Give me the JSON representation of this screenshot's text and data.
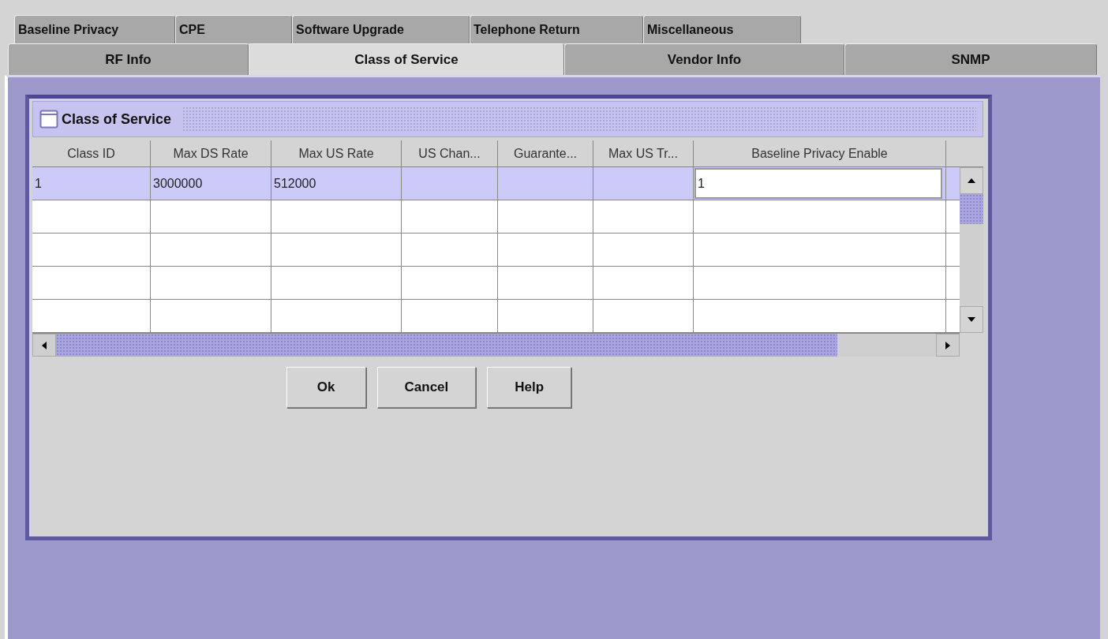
{
  "tab_rows": [
    {
      "tabs": [
        {
          "label": "Baseline Privacy",
          "selected": false
        },
        {
          "label": "CPE",
          "selected": false
        },
        {
          "label": "Software Upgrade",
          "selected": false
        },
        {
          "label": "Telephone Return",
          "selected": false
        },
        {
          "label": "Miscellaneous",
          "selected": false
        }
      ]
    },
    {
      "tabs": [
        {
          "label": "RF Info",
          "selected": false
        },
        {
          "label": "Class of Service",
          "selected": true
        },
        {
          "label": "Vendor Info",
          "selected": false
        },
        {
          "label": "SNMP",
          "selected": false
        }
      ]
    }
  ],
  "frame": {
    "title": "Class of Service"
  },
  "table": {
    "columns": [
      "Class ID",
      "Max DS Rate",
      "Max US Rate",
      "US Chan...",
      "Guarante...",
      "Max US Tr...",
      "Baseline Privacy Enable"
    ],
    "rows": [
      {
        "selected": true,
        "cells": [
          {
            "text": "1",
            "editing": false
          },
          {
            "text": "3000000",
            "editing": false
          },
          {
            "text": "512000",
            "editing": false
          },
          {
            "editing": false
          },
          {
            "editing": false
          },
          {
            "editing": false
          },
          {
            "text": "1",
            "editing": true
          }
        ]
      },
      {
        "selected": false,
        "cells": [
          {
            "editing": false
          },
          {
            "editing": false
          },
          {
            "editing": false
          },
          {
            "editing": false
          },
          {
            "editing": false
          },
          {
            "editing": false
          },
          {
            "editing": false
          }
        ]
      },
      {
        "selected": false,
        "cells": [
          {
            "editing": false
          },
          {
            "editing": false
          },
          {
            "editing": false
          },
          {
            "editing": false
          },
          {
            "editing": false
          },
          {
            "editing": false
          },
          {
            "editing": false
          }
        ]
      },
      {
        "selected": false,
        "cells": [
          {
            "editing": false
          },
          {
            "editing": false
          },
          {
            "editing": false
          },
          {
            "editing": false
          },
          {
            "editing": false
          },
          {
            "editing": false
          },
          {
            "editing": false
          }
        ]
      },
      {
        "selected": false,
        "cells": [
          {
            "editing": false
          },
          {
            "editing": false
          },
          {
            "editing": false
          },
          {
            "editing": false
          },
          {
            "editing": false
          },
          {
            "editing": false
          },
          {
            "editing": false
          }
        ]
      }
    ]
  },
  "buttons": [
    "Ok",
    "Cancel",
    "Help"
  ]
}
